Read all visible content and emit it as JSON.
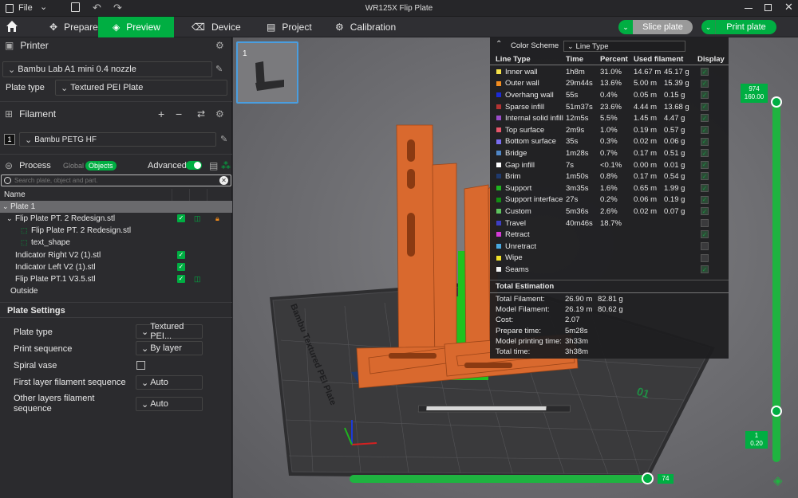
{
  "titlebar": {
    "file": "File",
    "title": "WR125X Flip Plate"
  },
  "tabs": {
    "prepare": "Prepare",
    "preview": "Preview",
    "device": "Device",
    "project": "Project",
    "calibration": "Calibration"
  },
  "actions": {
    "slice": "Slice plate",
    "print": "Print plate"
  },
  "printer": {
    "heading": "Printer",
    "name": "Bambu Lab A1 mini 0.4 nozzle",
    "plate_label": "Plate type",
    "plate_value": "Textured PEI Plate"
  },
  "filament": {
    "heading": "Filament",
    "slot": "1",
    "name": "Bambu PETG HF"
  },
  "process": {
    "heading": "Process",
    "global": "Global",
    "objects": "Objects",
    "advanced": "Advanced"
  },
  "search": {
    "placeholder": "Search plate, object and part."
  },
  "tree": {
    "name_col": "Name",
    "plate": "Plate 1",
    "items": [
      "Flip Plate PT. 2 Redesign.stl",
      "Flip Plate PT. 2 Redesign.stl",
      "text_shape",
      "Indicator Right V2 (1).stl",
      "Indicator Left V2 (1).stl",
      "Flip Plate PT.1 V3.5.stl",
      "Outside"
    ]
  },
  "plate_settings": {
    "heading": "Plate Settings",
    "rows": [
      {
        "label": "Plate type",
        "value": "Textured PEI..."
      },
      {
        "label": "Print sequence",
        "value": "By layer"
      },
      {
        "label": "Spiral vase",
        "value": ""
      },
      {
        "label": "First layer filament sequence",
        "value": "Auto"
      },
      {
        "label": "Other layers filament sequence",
        "value": "Auto"
      }
    ]
  },
  "legend": {
    "scheme_label": "Color Scheme",
    "scheme_value": "Line Type",
    "headers": [
      "Line Type",
      "Time",
      "Percent",
      "Used filament",
      "Display"
    ],
    "rows": [
      {
        "name": "Inner wall",
        "time": "1h8m",
        "pct": "31.0%",
        "len": "14.67 m",
        "wt": "45.17 g",
        "color": "#f5e14a",
        "show": true
      },
      {
        "name": "Outer wall",
        "time": "29m44s",
        "pct": "13.6%",
        "len": "5.00 m",
        "wt": "15.39 g",
        "color": "#f28c1f",
        "show": true
      },
      {
        "name": "Overhang wall",
        "time": "55s",
        "pct": "0.4%",
        "len": "0.05 m",
        "wt": "0.15 g",
        "color": "#1c2bd6",
        "show": true
      },
      {
        "name": "Sparse infill",
        "time": "51m37s",
        "pct": "23.6%",
        "len": "4.44 m",
        "wt": "13.68 g",
        "color": "#b33333",
        "show": true
      },
      {
        "name": "Internal solid infill",
        "time": "12m5s",
        "pct": "5.5%",
        "len": "1.45 m",
        "wt": "4.47 g",
        "color": "#9a4cc9",
        "show": true
      },
      {
        "name": "Top surface",
        "time": "2m9s",
        "pct": "1.0%",
        "len": "0.19 m",
        "wt": "0.57 g",
        "color": "#e6566a",
        "show": true
      },
      {
        "name": "Bottom surface",
        "time": "35s",
        "pct": "0.3%",
        "len": "0.02 m",
        "wt": "0.06 g",
        "color": "#7a6df0",
        "show": true
      },
      {
        "name": "Bridge",
        "time": "1m28s",
        "pct": "0.7%",
        "len": "0.17 m",
        "wt": "0.51 g",
        "color": "#4f86c6",
        "show": true
      },
      {
        "name": "Gap infill",
        "time": "7s",
        "pct": "<0.1%",
        "len": "0.00 m",
        "wt": "0.01 g",
        "color": "#ffffff",
        "show": true
      },
      {
        "name": "Brim",
        "time": "1m50s",
        "pct": "0.8%",
        "len": "0.17 m",
        "wt": "0.54 g",
        "color": "#1f3a6e",
        "show": true
      },
      {
        "name": "Support",
        "time": "3m35s",
        "pct": "1.6%",
        "len": "0.65 m",
        "wt": "1.99 g",
        "color": "#1fb31f",
        "show": true
      },
      {
        "name": "Support interface",
        "time": "27s",
        "pct": "0.2%",
        "len": "0.06 m",
        "wt": "0.19 g",
        "color": "#138f13",
        "show": true
      },
      {
        "name": "Custom",
        "time": "5m36s",
        "pct": "2.6%",
        "len": "0.02 m",
        "wt": "0.07 g",
        "color": "#5ec35e",
        "show": true
      },
      {
        "name": "Travel",
        "time": "40m46s",
        "pct": "18.7%",
        "len": "",
        "wt": "",
        "color": "#3e3ec4",
        "show": false
      },
      {
        "name": "Retract",
        "time": "",
        "pct": "",
        "len": "",
        "wt": "",
        "color": "#d63ad6",
        "show": true
      },
      {
        "name": "Unretract",
        "time": "",
        "pct": "",
        "len": "",
        "wt": "",
        "color": "#49a9e0",
        "show": false
      },
      {
        "name": "Wipe",
        "time": "",
        "pct": "",
        "len": "",
        "wt": "",
        "color": "#f0e02a",
        "show": false
      },
      {
        "name": "Seams",
        "time": "",
        "pct": "",
        "len": "",
        "wt": "",
        "color": "#f2f2f2",
        "show": true
      }
    ],
    "total_heading": "Total Estimation",
    "totals": [
      {
        "label": "Total Filament:",
        "v1": "26.90 m",
        "v2": "82.81 g"
      },
      {
        "label": "Model Filament:",
        "v1": "26.19 m",
        "v2": "80.62 g"
      },
      {
        "label": "Cost:",
        "v1": "2.07",
        "v2": ""
      },
      {
        "label": "Prepare time:",
        "v1": "5m28s",
        "v2": ""
      },
      {
        "label": "Model printing time:",
        "v1": "3h33m",
        "v2": ""
      },
      {
        "label": "Total time:",
        "v1": "3h38m",
        "v2": ""
      }
    ]
  },
  "viewport": {
    "plate_thumb_num": "1",
    "bed_text": "Bambu Textured PEI Plate",
    "bed_num": "01"
  },
  "slider": {
    "top_layer": "974",
    "top_height": "160.00",
    "bottom_layer": "1",
    "bottom_height": "0.20",
    "horizontal_value": "74"
  },
  "colors": {
    "accent": "#00ae42",
    "model": "#d9692e"
  }
}
